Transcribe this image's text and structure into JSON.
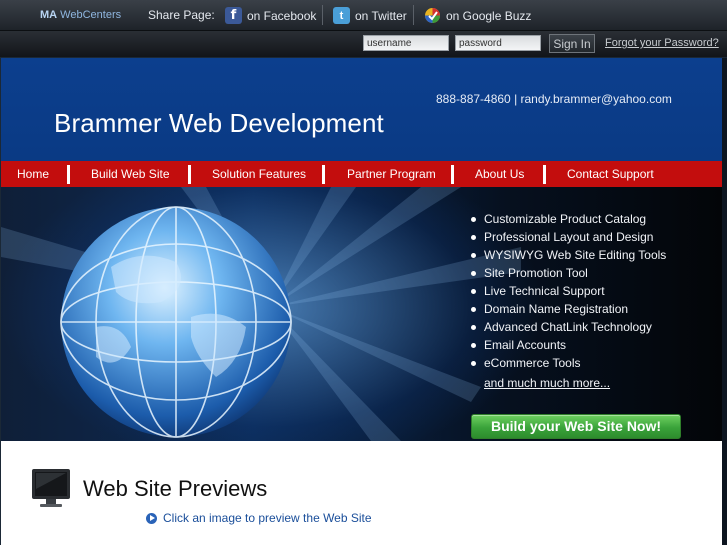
{
  "topbar": {
    "brand_prefix": "MA",
    "brand_name": "WebCenters",
    "share_label": "Share Page:",
    "share": [
      {
        "label": "on Facebook",
        "icon": "facebook-icon"
      },
      {
        "label": "on Twitter",
        "icon": "twitter-icon"
      },
      {
        "label": "on Google Buzz",
        "icon": "google-buzz-icon"
      }
    ]
  },
  "login": {
    "username_placeholder": "username",
    "password_placeholder": "password",
    "signin_label": "Sign In",
    "forgot_label": "Forgot your Password?"
  },
  "header": {
    "title": "Brammer Web Development",
    "contact": "888-887-4860 | randy.brammer@yahoo.com"
  },
  "nav": {
    "items": [
      "Home",
      "Build Web Site",
      "Solution Features",
      "Partner Program",
      "About Us",
      "Contact Support"
    ]
  },
  "hero": {
    "features": [
      "Customizable Product Catalog",
      "Professional Layout and Design",
      "WYSIWYG Web Site Editing Tools",
      "Site Promotion Tool",
      "Live Technical Support",
      "Domain Name Registration",
      "Advanced ChatLink Technology",
      "Email Accounts",
      "eCommerce Tools"
    ],
    "more_link": "and much much more...",
    "cta_label": "Build your Web Site Now!"
  },
  "previews": {
    "title": "Web Site Previews",
    "hint": "Click an image to preview the Web Site"
  },
  "colors": {
    "header_blue": "#0c3f8e",
    "nav_red": "#c30d0d",
    "cta_green": "#3aa33a"
  }
}
